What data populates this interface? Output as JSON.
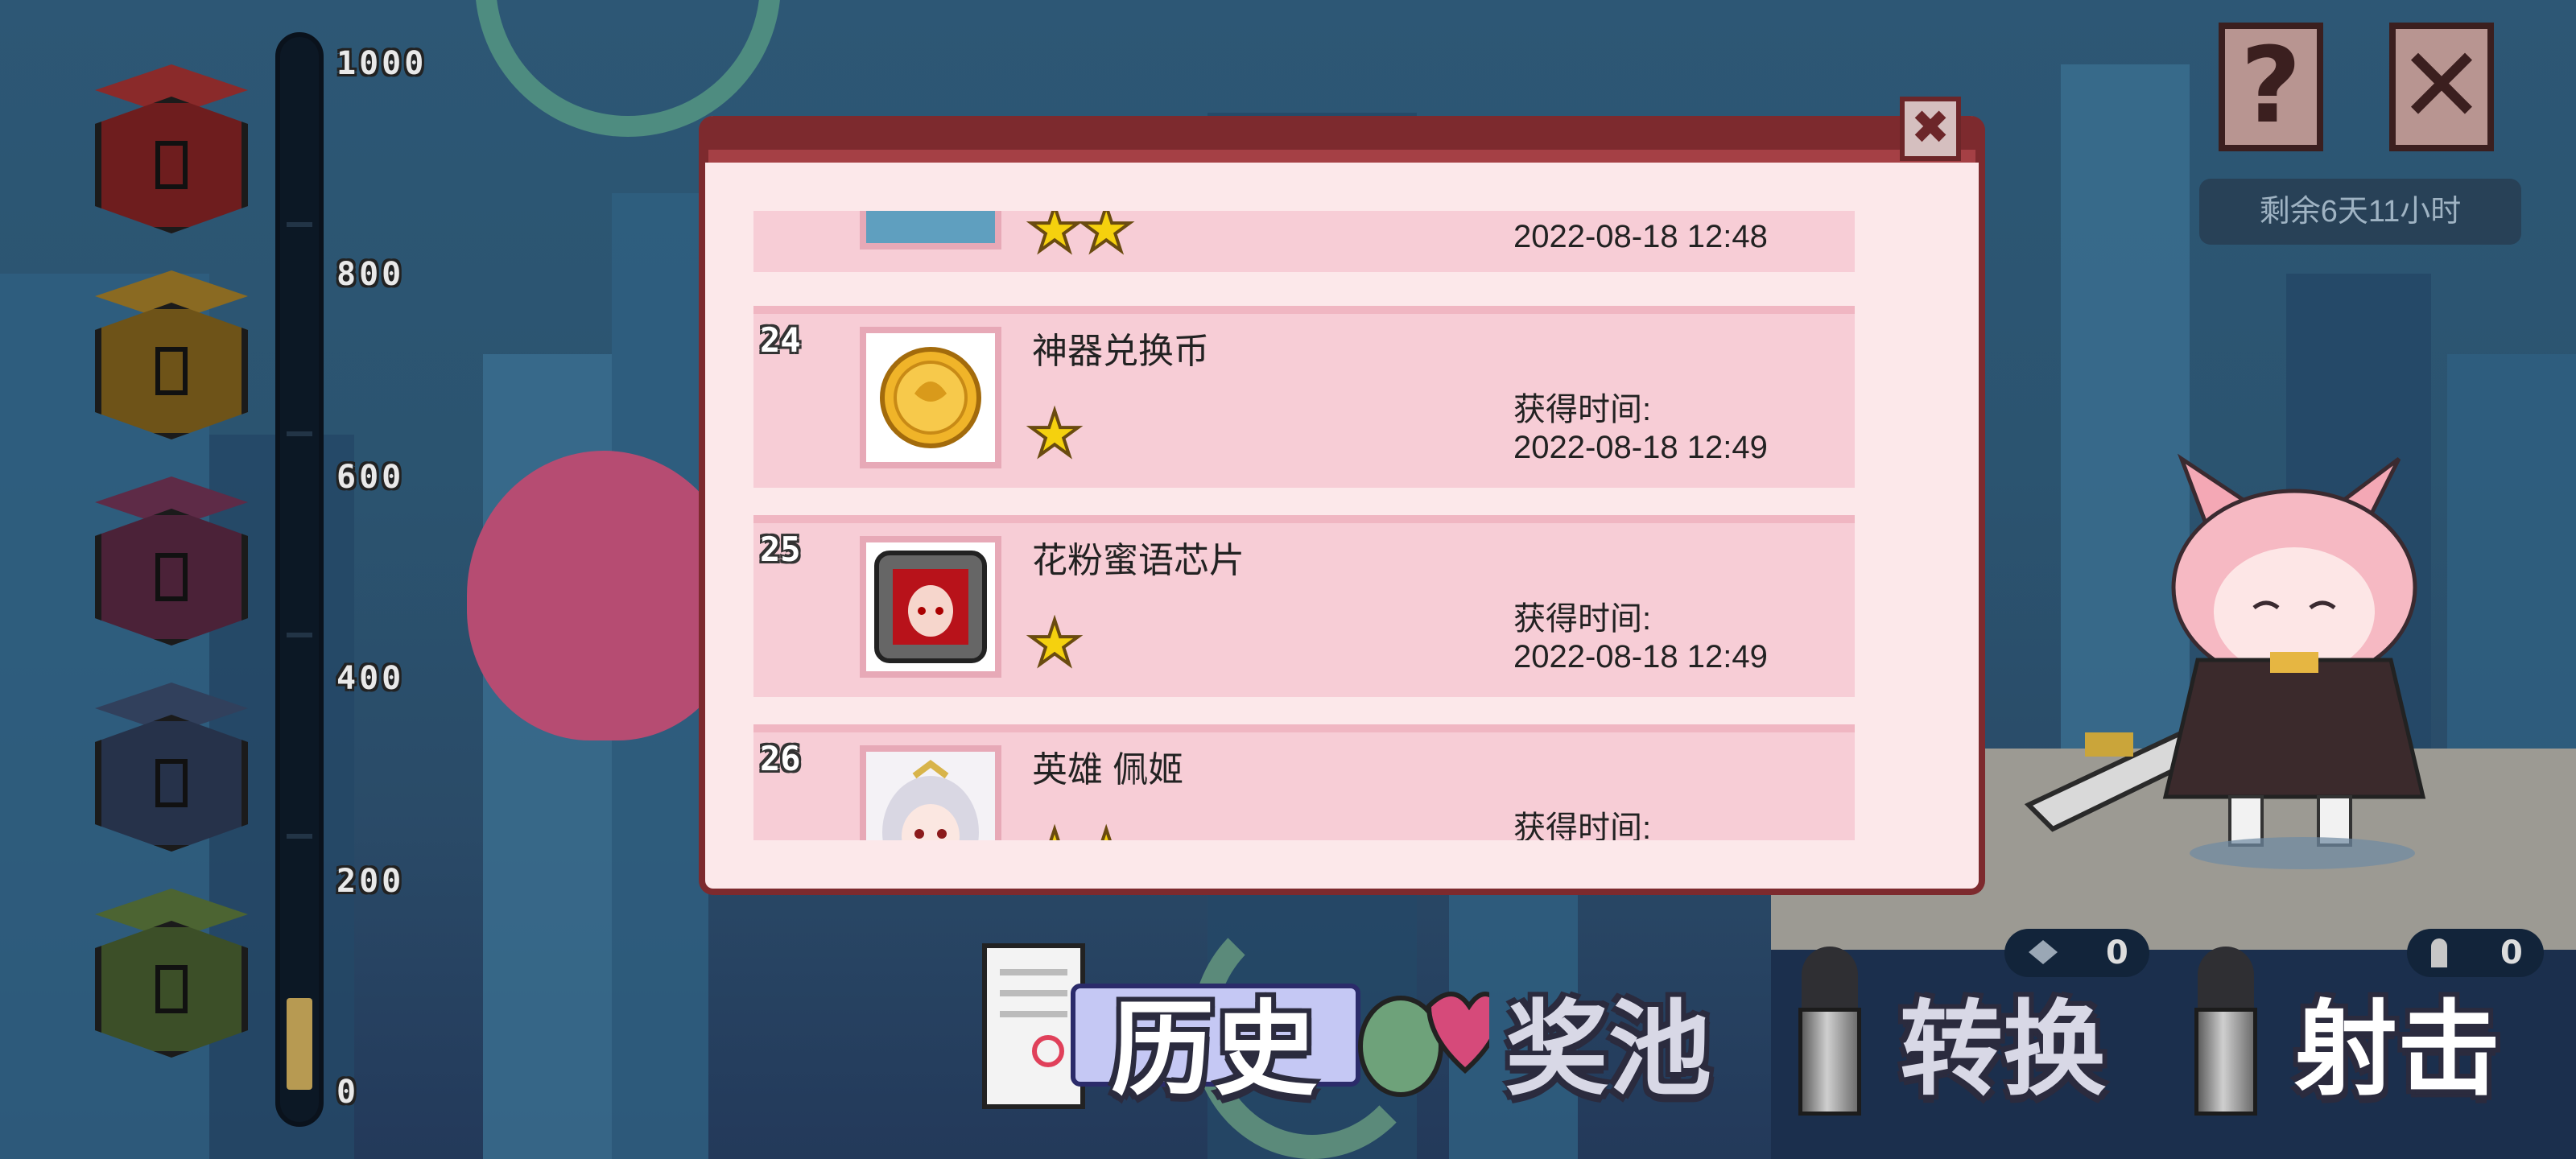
{
  "top_right": {
    "help_glyph": "?",
    "close_glyph": "✕",
    "remaining_time": "剩余6天11小时"
  },
  "progress": {
    "labels": [
      "1000",
      "800",
      "600",
      "400",
      "200",
      "0"
    ],
    "fill_fraction": 0.09
  },
  "chests": [
    {
      "color": "#6e1d1e",
      "lid": "#8a2a2a"
    },
    {
      "color": "#6e5318",
      "lid": "#8a6a22"
    },
    {
      "color": "#4b2238",
      "lid": "#5e2b47"
    },
    {
      "color": "#26324a",
      "lid": "#31405c"
    },
    {
      "color": "#3c4f28",
      "lid": "#4c6432"
    }
  ],
  "modal": {
    "close_glyph": "✖",
    "time_label": "获得时间:",
    "partial_top": {
      "stars": "★★",
      "time": "2022-08-18 12:48"
    },
    "items": [
      {
        "num": "24",
        "name": "神器兑换币",
        "stars": "★",
        "time": "2022-08-18 12:49",
        "icon": "coin-icon"
      },
      {
        "num": "25",
        "name": "花粉蜜语芯片",
        "stars": "★",
        "time": "2022-08-18 12:49",
        "icon": "chip-icon"
      },
      {
        "num": "26",
        "name": "英雄 佩姬",
        "stars": "★★",
        "time": "",
        "icon": "hero-portrait-icon"
      }
    ]
  },
  "bottom": {
    "history_label": "历史",
    "pool_label": "奖池",
    "convert_label": "转换",
    "shoot_label": "射击",
    "convert_count": "0",
    "shoot_count": "0"
  },
  "colors": {
    "modal_bg": "#fce8ea",
    "row_bg": "#f7cdd6",
    "frame": "#7d2a2e",
    "star": "#f5d10e"
  }
}
